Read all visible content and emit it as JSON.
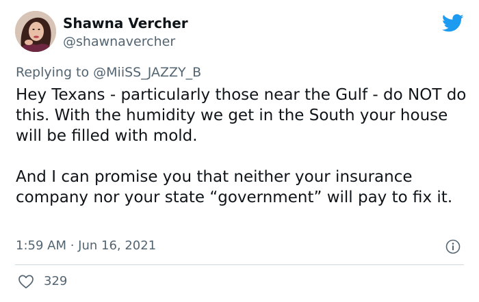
{
  "author": {
    "display_name": "Shawna Vercher",
    "handle": "@shawnavercher"
  },
  "reply": {
    "prefix": "Replying to ",
    "to_handle": "@MiiSS_JAZZY_B"
  },
  "tweet": {
    "paragraphs": [
      "Hey Texans - particularly those near the Gulf - do NOT do this. With the humidity we get in the South your house will be filled with mold.",
      "And I can promise you that neither your insurance company nor your state “government” will pay to fix it."
    ],
    "timestamp": "1:59 AM · Jun 16, 2021"
  },
  "engagement": {
    "likes": "329"
  },
  "icons": {
    "brand": "twitter-bird-icon",
    "info": "info-icon",
    "like": "heart-icon"
  },
  "colors": {
    "twitter_blue": "#1d9bf0",
    "secondary_text": "#536471",
    "primary_text": "#0f1419",
    "divider": "#cfd9de"
  }
}
